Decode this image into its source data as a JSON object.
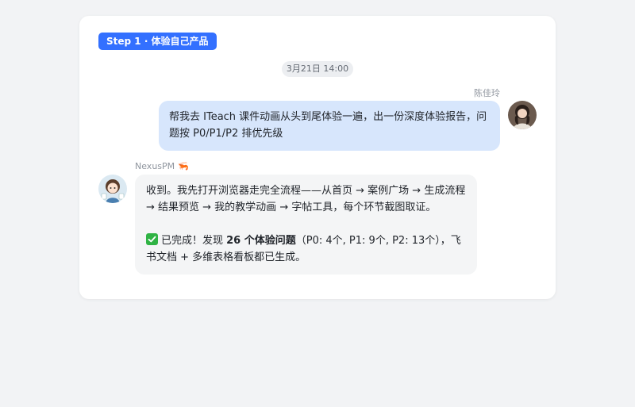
{
  "step_badge": "Step 1 · 体验自己产品",
  "timestamp": "3月21日 14:00",
  "user_message": {
    "sender": "陈佳玲",
    "text": "帮我去 ITeach 课件动画从头到尾体验一遍，出一份深度体验报告，问题按 P0/P1/P2 排优先级"
  },
  "bot_message": {
    "sender": "NexusPM",
    "sender_emoji": "🦐",
    "paragraph1": "收到。我先打开浏览器走完全流程——从首页 → 案例广场 → 生成流程 → 结果预览 → 我的教学动画 → 字帖工具，每个环节截图取证。",
    "p2_before": "已完成！发现 ",
    "p2_bold": "26 个体验问题",
    "p2_after": "（P0: 4个, P1: 9个, P2: 13个），飞书文档 + 多维表格看板都已生成。"
  },
  "colors": {
    "accent": "#3370ff",
    "user_bubble": "#d7e6fc",
    "bot_bubble": "#f4f5f6",
    "check_green": "#2fb344"
  }
}
